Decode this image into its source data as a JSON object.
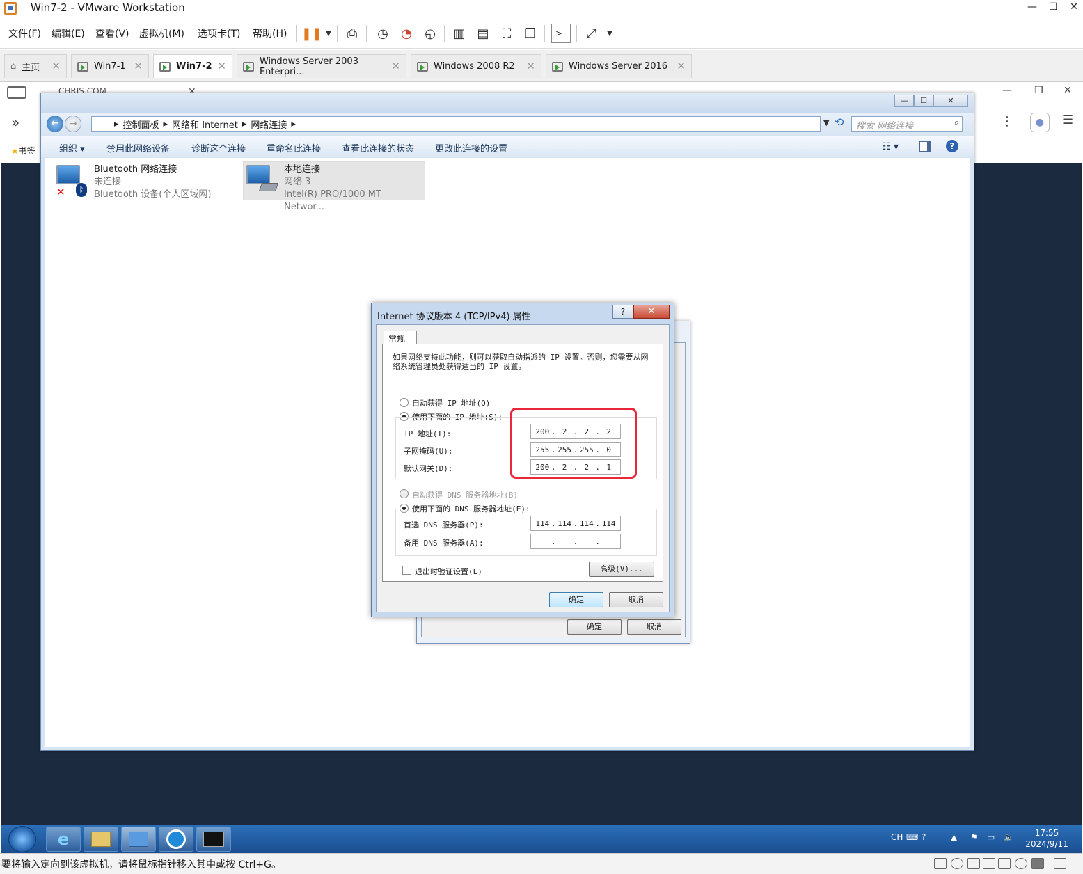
{
  "window": {
    "title": "Win7-2 - VMware Workstation",
    "minimize": "—",
    "maximize": "☐",
    "close": "✕"
  },
  "menu": [
    "文件(F)",
    "编辑(E)",
    "查看(V)",
    "虚拟机(M)",
    "选项卡(T)",
    "帮助(H)"
  ],
  "tabs": [
    {
      "label": "主页",
      "active": false
    },
    {
      "label": "Win7-1",
      "active": false
    },
    {
      "label": "Win7-2",
      "active": true
    },
    {
      "label": "Windows Server 2003 Enterpri...",
      "active": false
    },
    {
      "label": "Windows 2008 R2",
      "active": false
    },
    {
      "label": "Windows Server 2016",
      "active": false
    }
  ],
  "tab_close": "✕",
  "browser": {
    "tab_title": "CHRIS COM",
    "bookmarks_label": "书签",
    "expand_glyph": "»"
  },
  "explorer": {
    "breadcrumb": [
      "控制面板",
      "网络和 Internet",
      "网络连接"
    ],
    "search_placeholder": "搜索 网络连接",
    "commands": [
      "组织 ▾",
      "禁用此网络设备",
      "诊断这个连接",
      "重命名此连接",
      "查看此连接的状态",
      "更改此连接的设置"
    ],
    "items": [
      {
        "name": "Bluetooth 网络连接",
        "status": "未连接",
        "device": "Bluetooth 设备(个人区域网)"
      },
      {
        "name": "本地连接",
        "status": "网络  3",
        "device": "Intel(R) PRO/1000 MT Networ..."
      }
    ]
  },
  "dialog": {
    "title": "Internet 协议版本 4 (TCP/IPv4) 属性",
    "help": "?",
    "close": "✕",
    "tab": "常规",
    "description": "如果网络支持此功能，则可以获取自动指派的 IP 设置。否则，您需要从网络系统管理员处获得适当的 IP 设置。",
    "auto_ip": "自动获得 IP 地址(O)",
    "manual_ip": "使用下面的 IP 地址(S):",
    "ip_label": "IP 地址(I):",
    "mask_label": "子网掩码(U):",
    "gateway_label": "默认网关(D):",
    "ip": [
      "200",
      "2",
      "2",
      "2"
    ],
    "mask": [
      "255",
      "255",
      "255",
      "0"
    ],
    "gateway": [
      "200",
      "2",
      "2",
      "1"
    ],
    "auto_dns": "自动获得 DNS 服务器地址(B)",
    "manual_dns": "使用下面的 DNS 服务器地址(E):",
    "dns1_label": "首选 DNS 服务器(P):",
    "dns2_label": "备用 DNS 服务器(A):",
    "dns1": [
      "114",
      "114",
      "114",
      "114"
    ],
    "dns2": [
      "",
      "",
      "",
      ""
    ],
    "validate": "退出时验证设置(L)",
    "advanced": "高级(V)...",
    "ok": "确定",
    "cancel": "取消"
  },
  "back_dialog": {
    "ok": "确定",
    "cancel": "取消"
  },
  "taskbar": {
    "lang": "CH",
    "time": "17:55",
    "date": "2024/9/11"
  },
  "status": {
    "message": "要将输入定向到该虚拟机，请将鼠标指针移入其中或按 Ctrl+G。"
  },
  "colors": {
    "highlight": "#e8283a",
    "guest_background": "#1b2a3f",
    "taskbar": "#1a4d8f"
  }
}
